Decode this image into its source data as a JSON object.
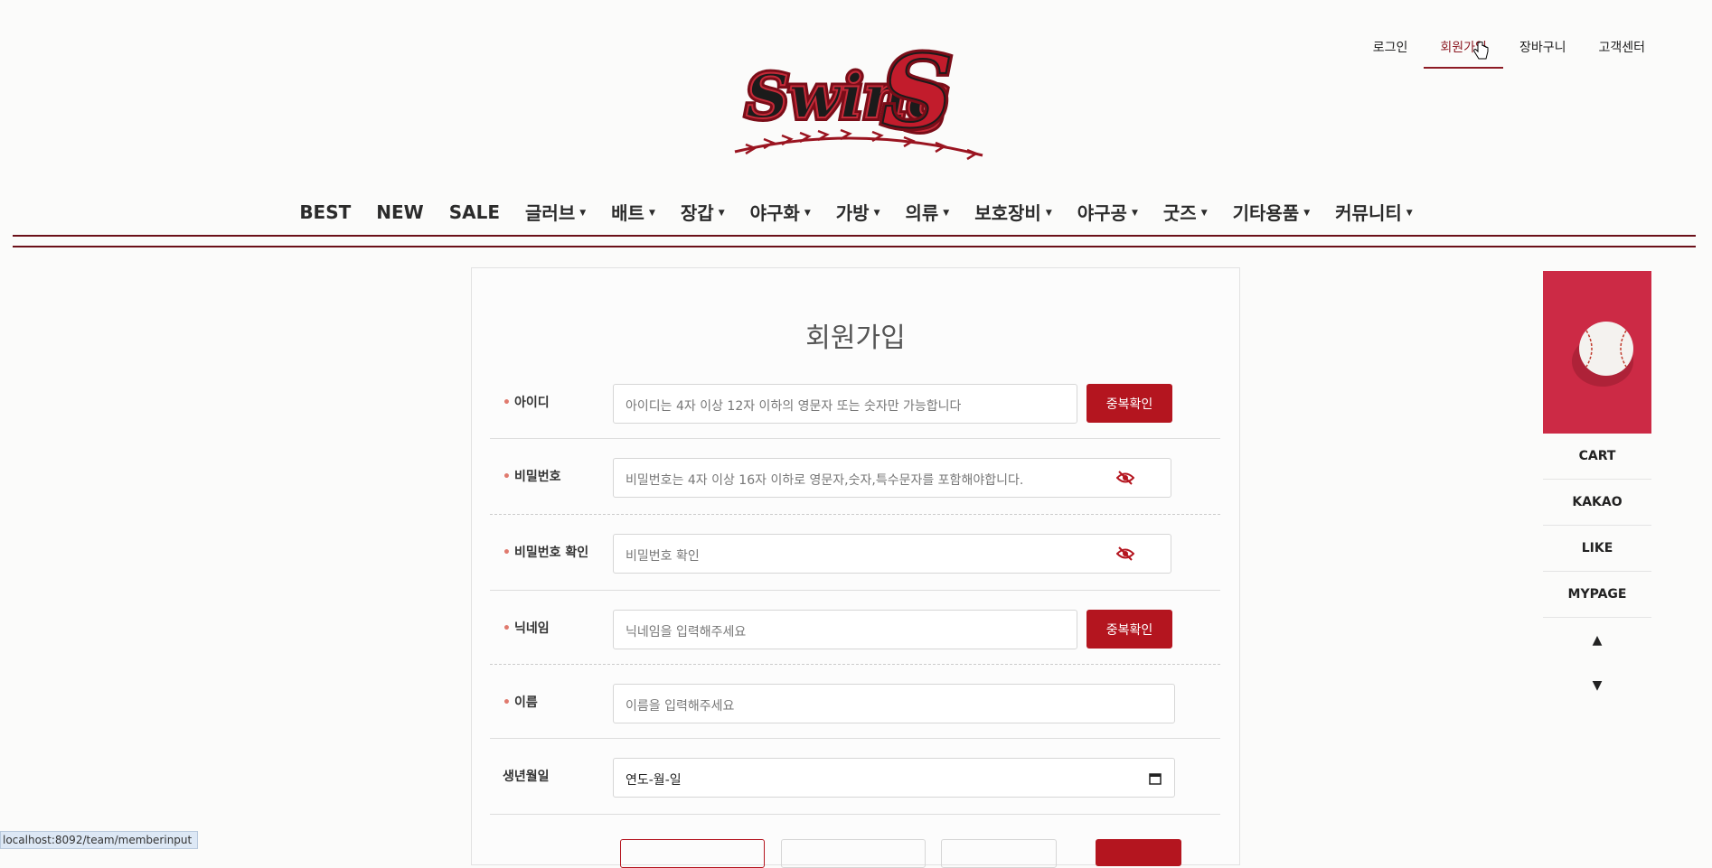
{
  "header": {
    "links": [
      "로그인",
      "회원가입",
      "장바구니",
      "고객센터"
    ],
    "active_link": "회원가입",
    "logo_icon": "swings-logo"
  },
  "nav": {
    "items": [
      {
        "label": "BEST",
        "dropdown": false
      },
      {
        "label": "NEW",
        "dropdown": false
      },
      {
        "label": "SALE",
        "dropdown": false
      },
      {
        "label": "글러브",
        "dropdown": true
      },
      {
        "label": "배트",
        "dropdown": true
      },
      {
        "label": "장갑",
        "dropdown": true
      },
      {
        "label": "야구화",
        "dropdown": true
      },
      {
        "label": "가방",
        "dropdown": true
      },
      {
        "label": "의류",
        "dropdown": true
      },
      {
        "label": "보호장비",
        "dropdown": true
      },
      {
        "label": "야구공",
        "dropdown": true
      },
      {
        "label": "굿즈",
        "dropdown": true
      },
      {
        "label": "기타용품",
        "dropdown": true
      },
      {
        "label": "커뮤니티",
        "dropdown": true
      }
    ]
  },
  "form": {
    "title": "회원가입",
    "required_mark": "•",
    "fields": {
      "id": {
        "label": "아이디",
        "placeholder": "아이디는 4자 이상 12자 이하의 영문자 또는 숫자만 가능합니다",
        "button": "중복확인"
      },
      "password": {
        "label": "비밀번호",
        "placeholder": "비밀번호는 4자 이상 16자 이하로 영문자,숫자,특수문자를 포함해야합니다."
      },
      "password_confirm": {
        "label": "비밀번호 확인",
        "placeholder": "비밀번호 확인"
      },
      "nickname": {
        "label": "닉네임",
        "placeholder": "닉네임을 입력해주세요",
        "button": "중복확인"
      },
      "name": {
        "label": "이름",
        "placeholder": "이름을 입력해주세요"
      },
      "birth": {
        "label": "생년월일",
        "value": "연도-월-일"
      }
    }
  },
  "side_menu": {
    "items": [
      "CART",
      "KAKAO",
      "LIKE",
      "MYPAGE"
    ],
    "up": "▲",
    "down": "▼",
    "image_icon": "baseball-image"
  },
  "status_bar": "localhost:8092/team/memberinput",
  "colors": {
    "accent": "#b4151f",
    "nav_line": "#6b1019",
    "side_image": "#cc2a45"
  }
}
